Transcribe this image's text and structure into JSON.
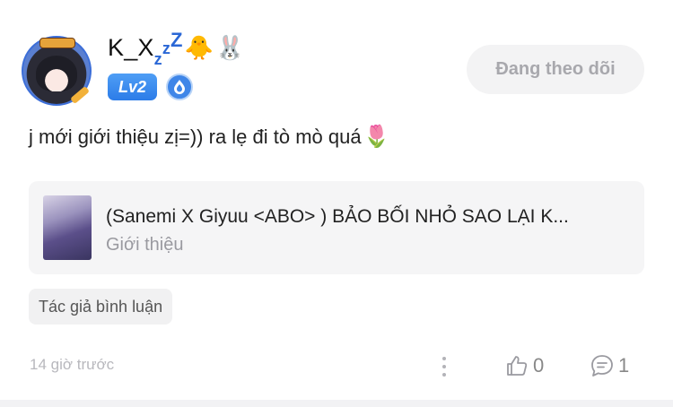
{
  "user": {
    "name_base": "K_X",
    "name_sub": "z",
    "name_sup1": "z",
    "name_sup2": "Z",
    "emoji_1": "🐥",
    "emoji_2": "🐰",
    "level": "Lv2"
  },
  "follow_button": {
    "label": "Đang theo dõi"
  },
  "comment": {
    "text": "j mới giới thiệu zị=)) ra lẹ đi tò mò quá",
    "emoji": "🌷"
  },
  "story": {
    "title": "(Sanemi X Giyuu <ABO> ) BẢO BỐI NHỎ SAO LẠI K...",
    "subtitle": "Giới thiệu"
  },
  "author_tag": "Tác giả bình luận",
  "footer": {
    "time": "14 giờ trước",
    "like_count": "0",
    "comment_count": "1"
  },
  "icons": {
    "medal": "medal-icon",
    "more": "more-vertical-icon",
    "like": "thumbs-up-icon",
    "comment": "comment-bubble-icon"
  },
  "colors": {
    "accent_blue": "#2c7ce8",
    "follow_bg": "#f3f3f4",
    "muted_text": "#9a9aa0"
  }
}
